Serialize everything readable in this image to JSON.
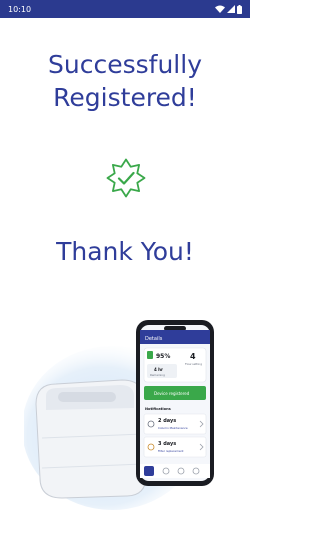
{
  "status_bar": {
    "time": "10:10"
  },
  "screen": {
    "headline_line1": "Successfully",
    "headline_line2": "Registered!",
    "thank_you": "Thank You!"
  },
  "phone_app": {
    "header": "Details",
    "battery_value": "95%",
    "level_value": "4",
    "level_caption": "Flow setting",
    "remaining_value": "4 hr",
    "remaining_caption": "Remaining",
    "status_button": "Device registered",
    "notifications_title": "Notifications",
    "row1_title": "2 days",
    "row1_sub": "Column Maintenance",
    "row2_title": "3 days",
    "row2_sub": "Filter replacement"
  },
  "colors": {
    "status_bar_bg": "#2b3a8f",
    "heading_text": "#2f3d9a",
    "check_badge": "#3aa84a"
  },
  "icons": [
    "wifi-icon",
    "signal-icon",
    "battery-icon",
    "check-badge-icon"
  ]
}
